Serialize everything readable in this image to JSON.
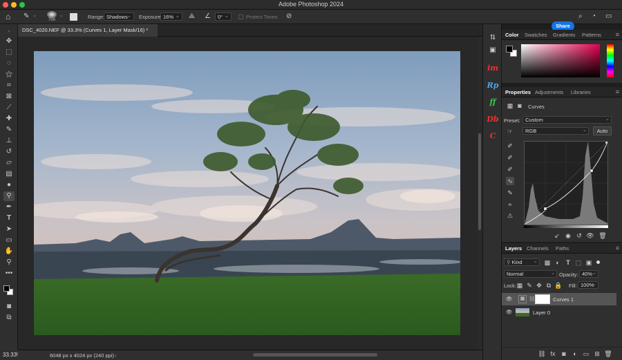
{
  "window": {
    "title": "Adobe Photoshop 2024"
  },
  "options": {
    "brush_size": "700",
    "range_label": "Range:",
    "range_value": "Shadows",
    "exposure_label": "Exposure:",
    "exposure_value": "16%",
    "angle_value": "0°",
    "protect_tones": "Protect Tones",
    "share": "Share"
  },
  "document": {
    "tab_title": "DSC_4020.NEF @ 33.3% (Curves 1, Layer Mask/16) *",
    "zoom": "33.33%",
    "info": "6048 px x 4024 px (240 ppi)"
  },
  "color_panel": {
    "tabs": [
      "Color",
      "Swatches",
      "Gradients",
      "Patterns"
    ]
  },
  "properties": {
    "tabs": [
      "Properties",
      "Adjustments",
      "Libraries"
    ],
    "type": "Curves",
    "preset_label": "Preset:",
    "preset_value": "Custom",
    "channel": "RGB",
    "auto": "Auto"
  },
  "layers_panel": {
    "tabs": [
      "Layers",
      "Channels",
      "Paths"
    ],
    "kind": "Kind",
    "blend_mode": "Normal",
    "opacity_label": "Opacity:",
    "opacity_value": "40%",
    "lock_label": "Lock:",
    "fill_label": "Fill:",
    "fill_value": "100%",
    "layers": [
      {
        "name": "Curves 1",
        "selected": true
      },
      {
        "name": "Layer 0",
        "selected": false
      }
    ]
  },
  "extensions": [
    "im",
    "Rp",
    "ff",
    "Db",
    "C"
  ],
  "icons": [
    "home-icon",
    "brush-icon",
    "move-icon",
    "marquee-icon",
    "lasso-icon",
    "magic-wand-icon",
    "crop-icon",
    "frame-icon",
    "eyedropper-icon",
    "healing-icon",
    "brush-tool-icon",
    "stamp-icon",
    "history-brush-icon",
    "eraser-icon",
    "gradient-icon",
    "blur-icon",
    "dodge-icon",
    "pen-icon",
    "type-icon",
    "path-select-icon",
    "rectangle-icon",
    "hand-icon",
    "zoom-icon",
    "search-icon",
    "learn-icon",
    "workspace-icon"
  ]
}
